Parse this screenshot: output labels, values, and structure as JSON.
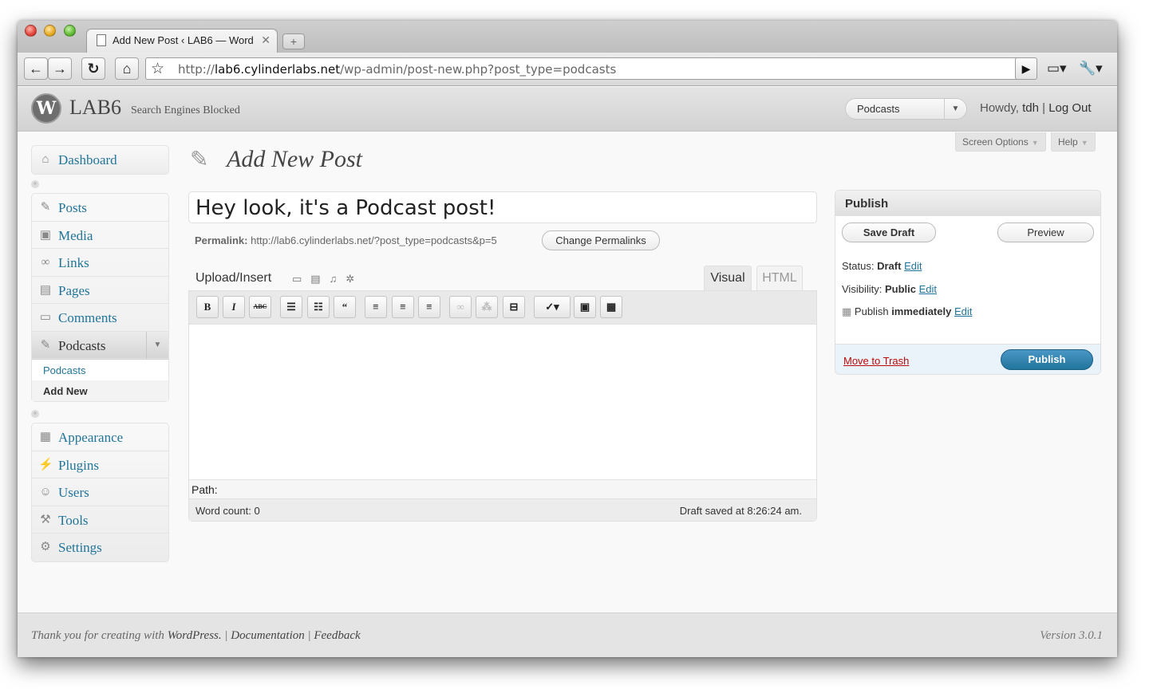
{
  "browser": {
    "tab_title": "Add New Post ‹ LAB6 — Word",
    "url_prefix": "http://",
    "url_host": "lab6.cylinderlabs.net",
    "url_path": "/wp-admin/post-new.php?post_type=podcasts"
  },
  "header": {
    "site_name": "LAB6",
    "site_note": "Search Engines Blocked",
    "favorite_action": "Podcasts",
    "howdy": "Howdy,",
    "user": "tdh",
    "separator": "|",
    "logout": "Log Out"
  },
  "screen_meta": {
    "screen_options": "Screen Options",
    "help": "Help"
  },
  "sidebar": {
    "top": [
      {
        "label": "Dashboard",
        "icon": "home-icon"
      }
    ],
    "main": [
      {
        "label": "Posts",
        "icon": "pushpin-icon"
      },
      {
        "label": "Media",
        "icon": "media-icon"
      },
      {
        "label": "Links",
        "icon": "link-icon"
      },
      {
        "label": "Pages",
        "icon": "pages-icon"
      },
      {
        "label": "Comments",
        "icon": "comment-icon"
      },
      {
        "label": "Podcasts",
        "icon": "pushpin-icon"
      }
    ],
    "podcasts_sub": [
      "Podcasts",
      "Add New"
    ],
    "bottom": [
      {
        "label": "Appearance",
        "icon": "appearance-icon"
      },
      {
        "label": "Plugins",
        "icon": "plugin-icon"
      },
      {
        "label": "Users",
        "icon": "users-icon"
      },
      {
        "label": "Tools",
        "icon": "tools-icon"
      },
      {
        "label": "Settings",
        "icon": "settings-icon"
      }
    ]
  },
  "main": {
    "page_title": "Add New Post",
    "post_title": "Hey look, it's a Podcast post!",
    "permalink_label": "Permalink:",
    "permalink_url": "http://lab6.cylinderlabs.net/?post_type=podcasts&p=5",
    "change_permalinks": "Change Permalinks",
    "upload_insert": "Upload/Insert",
    "tab_visual": "Visual",
    "tab_html": "HTML",
    "path_label": "Path:",
    "word_count": "Word count: 0",
    "draft_saved": "Draft saved at 8:26:24 am."
  },
  "publish": {
    "title": "Publish",
    "save_draft": "Save Draft",
    "preview": "Preview",
    "status_label": "Status:",
    "status_value": "Draft",
    "visibility_label": "Visibility:",
    "visibility_value": "Public",
    "publish_label": "Publish",
    "publish_value": "immediately",
    "edit": "Edit",
    "move_to_trash": "Move to Trash",
    "publish_button": "Publish"
  },
  "footer": {
    "thanks": "Thank you for creating with",
    "wordpress": "WordPress.",
    "sep": "|",
    "documentation": "Documentation",
    "feedback": "Feedback",
    "version": "Version 3.0.1"
  },
  "colors": {
    "link": "#21759b",
    "publish_button": "#21759b",
    "trash": "#bc0b0b"
  }
}
